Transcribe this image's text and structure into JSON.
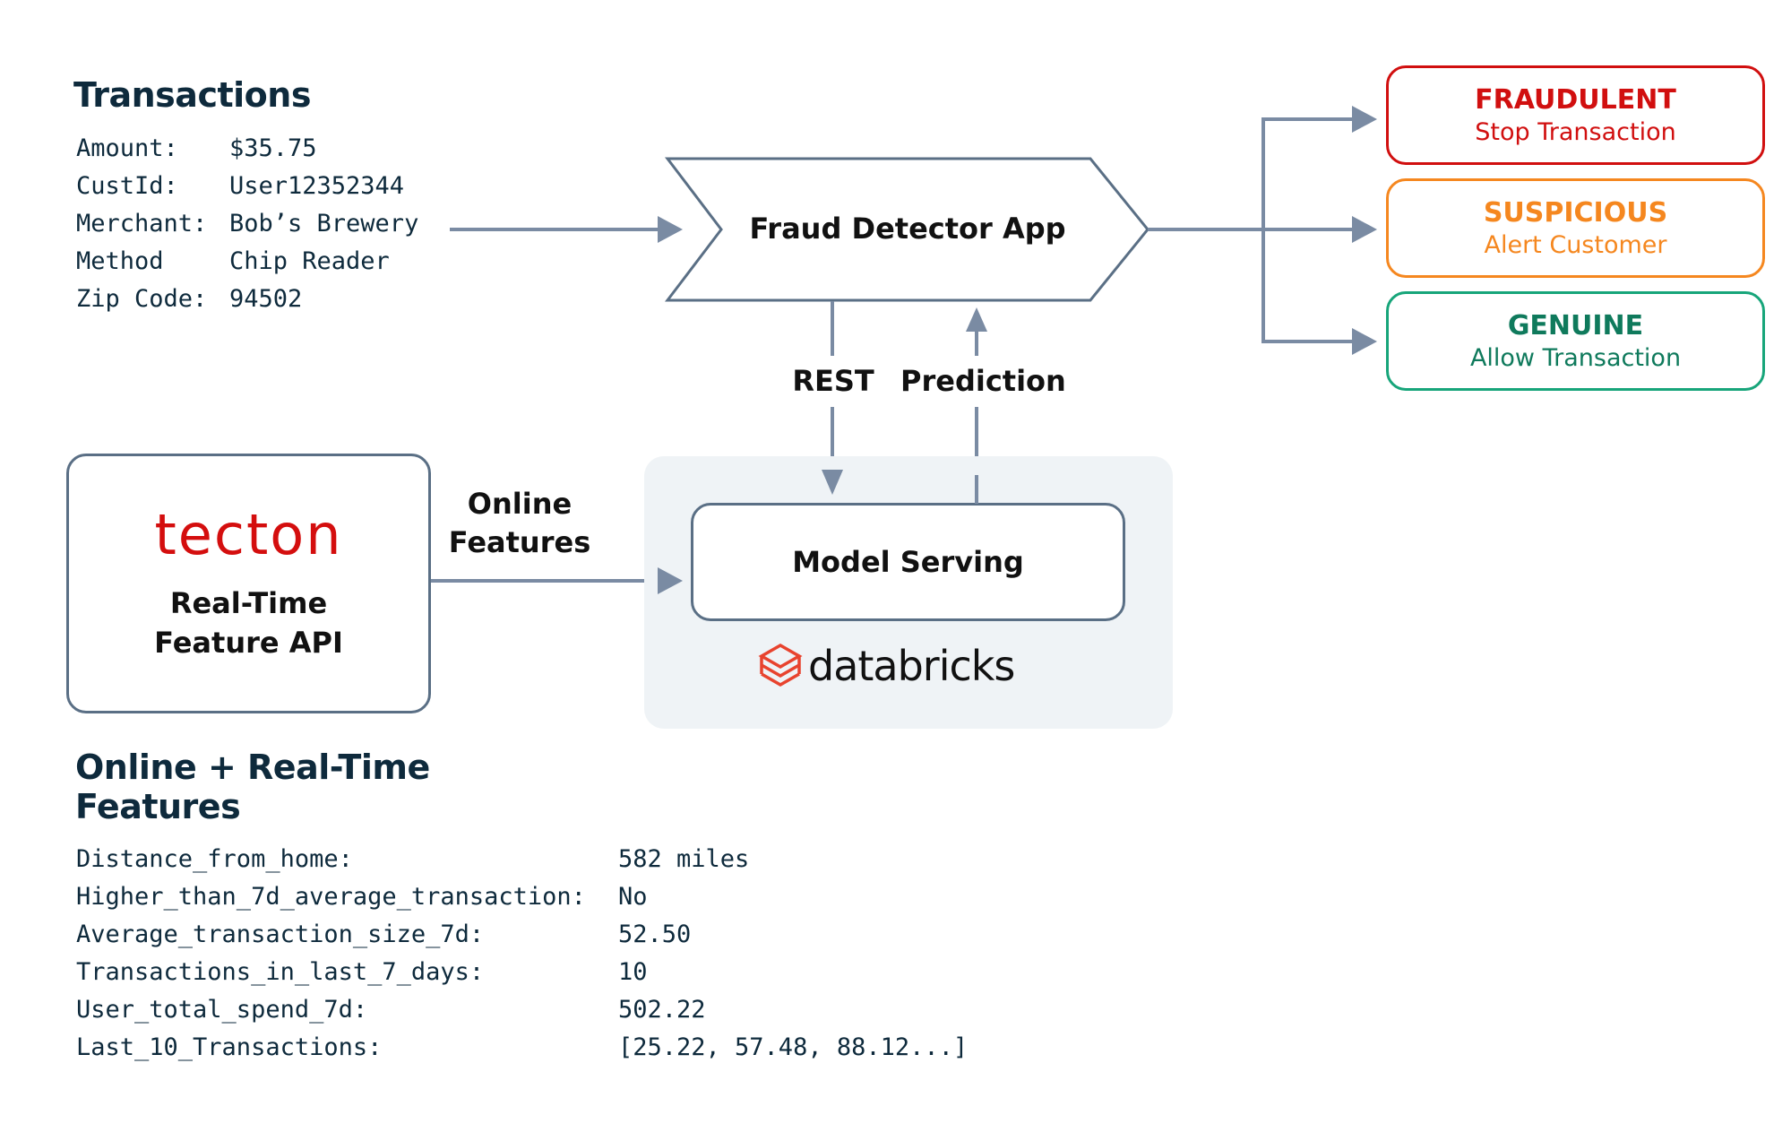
{
  "transactions": {
    "title": "Transactions",
    "rows": [
      {
        "key": "Amount:",
        "value": "$35.75"
      },
      {
        "key": "CustId:",
        "value": "User12352344"
      },
      {
        "key": "Merchant:",
        "value": "Bob’s Brewery"
      },
      {
        "key": "Method",
        "value": "Chip Reader"
      },
      {
        "key": "Zip Code:",
        "value": "94502"
      }
    ]
  },
  "app": {
    "label": "Fraud Detector App"
  },
  "links": {
    "rest": "REST",
    "prediction": "Prediction",
    "online_features_line1": "Online",
    "online_features_line2": "Features"
  },
  "outcomes": [
    {
      "title": "FRAUDULENT",
      "subtitle": "Stop Transaction",
      "color": "#d10f0f"
    },
    {
      "title": "SUSPICIOUS",
      "subtitle": "Alert Customer",
      "color": "#f5871f"
    },
    {
      "title": "GENUINE",
      "subtitle": "Allow Transaction",
      "color": "#0f7a5c",
      "border": "#17a57a"
    }
  ],
  "tecton": {
    "logo": "tecton",
    "line1": "Real-Time",
    "line2": "Feature API",
    "brand_color": "#d40e0e"
  },
  "databricks": {
    "serving_label": "Model Serving",
    "logo": "databricks",
    "brand_color": "#e8432e"
  },
  "features": {
    "title_line1": "Online + Real-Time",
    "title_line2": "Features",
    "rows": [
      {
        "key": "Distance_from_home:",
        "value": "582 miles"
      },
      {
        "key": "Higher_than_7d_average_transaction:",
        "value": "No"
      },
      {
        "key": "Average_transaction_size_7d:",
        "value": "52.50"
      },
      {
        "key": "Transactions_in_last_7_days:",
        "value": "10"
      },
      {
        "key": "User_total_spend_7d:",
        "value": "502.22"
      },
      {
        "key": "Last_10_Transactions:",
        "value": "[25.22, 57.48, 88.12...]"
      }
    ]
  },
  "colors": {
    "connector": "#7a8ba3",
    "heading": "#0e2a3c"
  }
}
